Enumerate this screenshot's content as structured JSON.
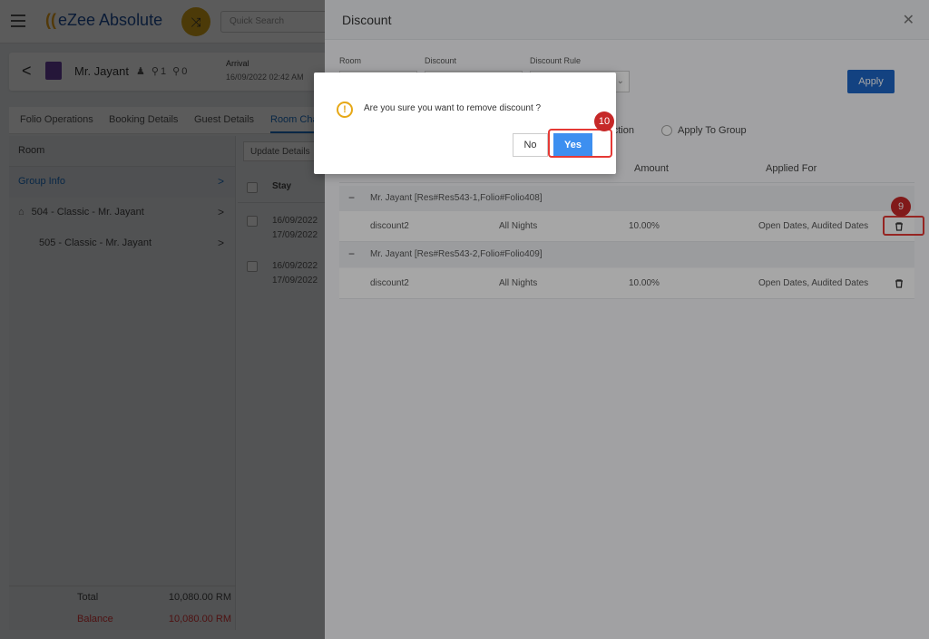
{
  "app": {
    "logo_text": "eZee Absolute",
    "search_placeholder": "Quick Search"
  },
  "guest": {
    "name": "Mr. Jayant",
    "icons_text": "♟ ⚲1 ⚲0",
    "arrival_label": "Arrival",
    "arrival_value": "16/09/2022 02:42 AM"
  },
  "tabs": [
    "Folio Operations",
    "Booking Details",
    "Guest Details",
    "Room Cha"
  ],
  "left_panel": {
    "header": "Room",
    "items": [
      {
        "label": "Group Info"
      },
      {
        "label": "504 - Classic - Mr. Jayant"
      },
      {
        "label": "505 - Classic - Mr. Jayant"
      }
    ],
    "total_label": "Total",
    "total_value": "10,080.00 RM",
    "balance_label": "Balance",
    "balance_value": "10,080.00 RM"
  },
  "mid_panel": {
    "update_button": "Update Details",
    "stay_header": "Stay",
    "rows": [
      {
        "d1": "16/09/2022",
        "d2": "17/09/2022"
      },
      {
        "d1": "16/09/2022",
        "d2": "17/09/2022"
      }
    ]
  },
  "drawer": {
    "title": "Discount",
    "room_label": "Room",
    "discount_label": "Discount",
    "rule_label": "Discount Rule",
    "apply_button": "Apply",
    "radio_transaction": "nsaction",
    "radio_group": "Apply To Group",
    "columns": {
      "amount": "Amount",
      "applied_for": "Applied For"
    },
    "groups": [
      {
        "title": "Mr. Jayant [Res#Res543-1,Folio#Folio408]",
        "row": {
          "name": "discount2",
          "nights": "All Nights",
          "amount": "10.00%",
          "applied": "Open Dates, Audited Dates"
        }
      },
      {
        "title": "Mr. Jayant [Res#Res543-2,Folio#Folio409]",
        "row": {
          "name": "discount2",
          "nights": "All Nights",
          "amount": "10.00%",
          "applied": "Open Dates, Audited Dates"
        }
      }
    ]
  },
  "dialog": {
    "message": "Are you sure you want to remove discount ?",
    "no_button": "No",
    "yes_button": "Yes"
  },
  "annotations": {
    "step_trash": "9",
    "step_yes": "10"
  }
}
